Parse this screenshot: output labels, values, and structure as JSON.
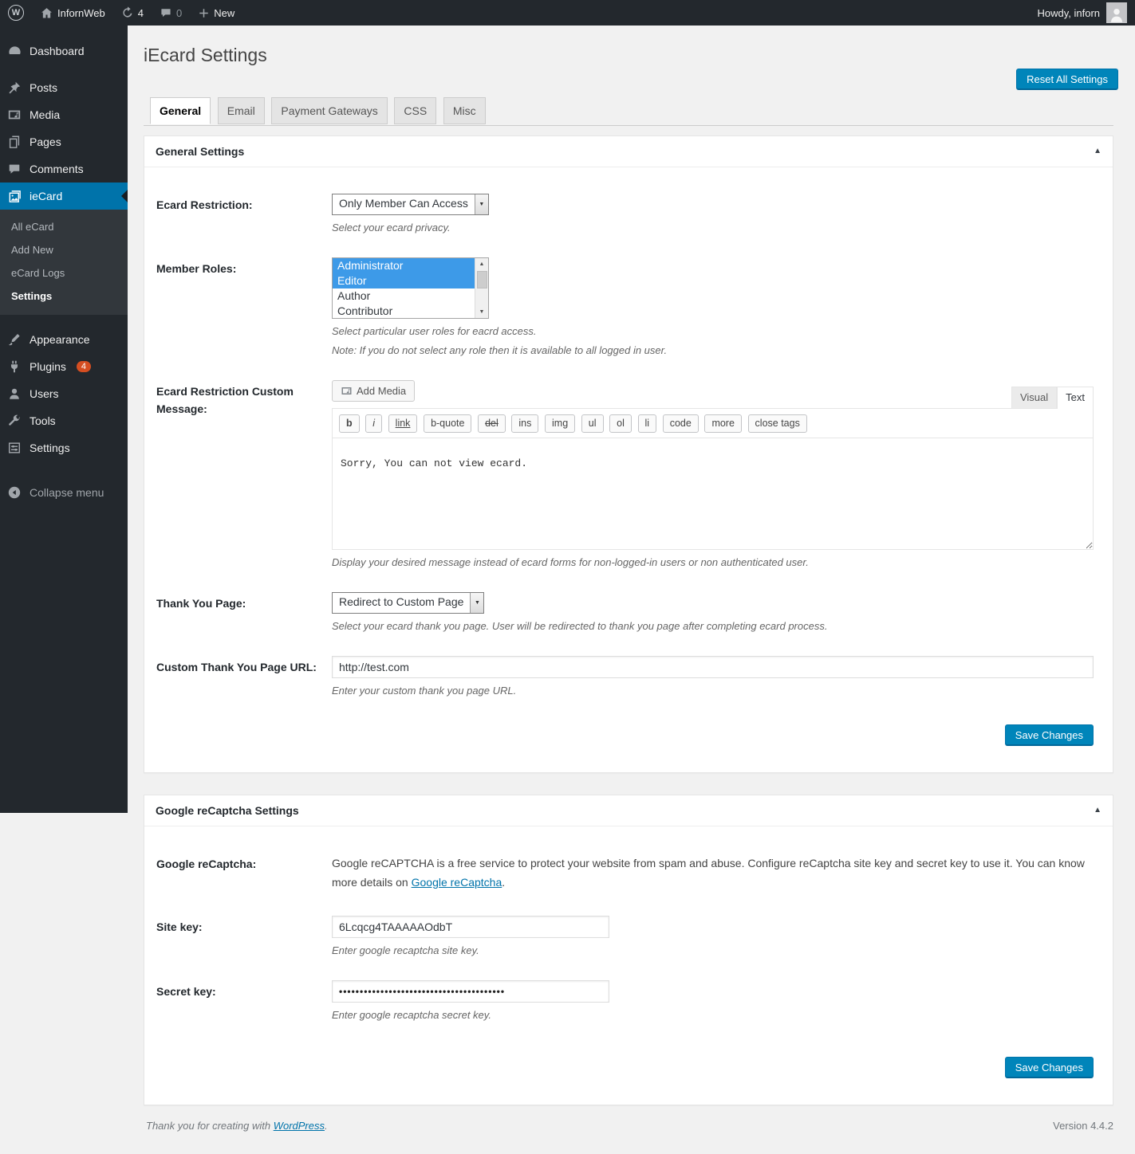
{
  "admin_bar": {
    "site_name": "InfornWeb",
    "updates_count": "4",
    "comments_count": "0",
    "new_label": "New",
    "howdy": "Howdy, inforn"
  },
  "sidebar": {
    "items": [
      {
        "label": "Dashboard"
      },
      {
        "label": "Posts"
      },
      {
        "label": "Media"
      },
      {
        "label": "Pages"
      },
      {
        "label": "Comments"
      },
      {
        "label": "ieCard"
      },
      {
        "label": "Appearance"
      },
      {
        "label": "Plugins",
        "badge": "4"
      },
      {
        "label": "Users"
      },
      {
        "label": "Tools"
      },
      {
        "label": "Settings"
      },
      {
        "label": "Collapse menu"
      }
    ],
    "iecard_submenu": [
      "All eCard",
      "Add New",
      "eCard Logs",
      "Settings"
    ],
    "active_item": "ieCard",
    "active_submenu": "Settings"
  },
  "page": {
    "title": "iEcard Settings",
    "reset_button": "Reset All Settings",
    "tabs": [
      "General",
      "Email",
      "Payment Gateways",
      "CSS",
      "Misc"
    ],
    "active_tab": "General"
  },
  "general_section": {
    "title": "General Settings",
    "ecard_restriction": {
      "label": "Ecard Restriction:",
      "value": "Only Member Can Access",
      "help": "Select your ecard privacy."
    },
    "member_roles": {
      "label": "Member Roles:",
      "options": [
        "Administrator",
        "Editor",
        "Author",
        "Contributor"
      ],
      "selected": [
        "Administrator",
        "Editor"
      ],
      "help": "Select particular user roles for eacrd access.",
      "note": "Note: If you do not select any role then it is available to all logged in user."
    },
    "custom_message": {
      "label": "Ecard Restriction Custom Message:",
      "add_media_label": "Add Media",
      "visual_tab": "Visual",
      "text_tab": "Text",
      "toolbar": [
        "b",
        "i",
        "link",
        "b-quote",
        "del",
        "ins",
        "img",
        "ul",
        "ol",
        "li",
        "code",
        "more",
        "close tags"
      ],
      "value": "Sorry, You can not view ecard.",
      "help": "Display your desired message instead of ecard forms for non-logged-in users or non authenticated user."
    },
    "thank_you_page": {
      "label": "Thank You Page:",
      "value": "Redirect to Custom Page",
      "help": "Select your ecard thank you page. User will be redirected to thank you page after completing ecard process."
    },
    "custom_url": {
      "label": "Custom Thank You Page URL:",
      "value": "http://test.com",
      "help": "Enter your custom thank you page URL."
    },
    "save_button": "Save Changes"
  },
  "recaptcha_section": {
    "title": "Google reCaptcha Settings",
    "recaptcha": {
      "label": "Google reCaptcha:",
      "text_line": "Google reCAPTCHA is a free service to protect your website from spam and abuse. Configure reCaptcha site key and secret key to use it. You can know more details on ",
      "link": "Google reCaptcha",
      "period": "."
    },
    "site_key": {
      "label": "Site key:",
      "value": "6Lcqcg4TAAAAAOdbT",
      "help": "Enter google recaptcha site key."
    },
    "secret_key": {
      "label": "Secret key:",
      "value": "••••••••••••••••••••••••••••••••••••••••",
      "help": "Enter google recaptcha secret key."
    },
    "save_button": "Save Changes"
  },
  "footer": {
    "left_text": "Thank you for creating with ",
    "left_link": "WordPress",
    "left_period": ".",
    "version": "Version 4.4.2"
  },
  "colors": {
    "admin_bar_bg": "#23282d",
    "sidebar_bg": "#23282d",
    "submenu_bg": "#32373c",
    "active_menu_blue": "#0073aa",
    "primary_button_blue": "#0085ba",
    "plugins_badge": "#d54e21",
    "listbox_selection_blue": "#3d9ae8",
    "body_bg": "#f1f1f1",
    "link_blue": "#0073aa"
  }
}
